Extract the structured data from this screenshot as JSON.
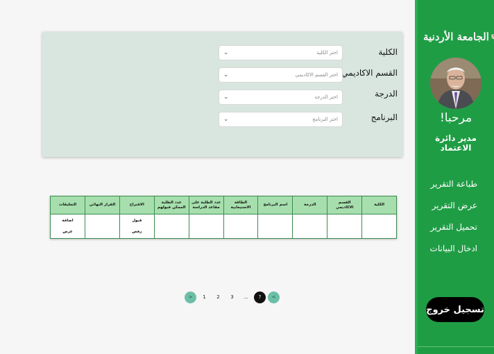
{
  "sidebar": {
    "logo_text": "الجامعة الأردنية",
    "greeting": "مرحبا!",
    "role": "مدير دائرة الاعتماد",
    "menu": [
      {
        "label": "طباعة التقرير"
      },
      {
        "label": "عرض التقرير"
      },
      {
        "label": "تحميل التقرير"
      },
      {
        "label": "ادخال البيانات"
      }
    ],
    "logout_label": "تسجيل خروج",
    "colors": {
      "background": "#1f9d45",
      "logout_bg": "#000000"
    }
  },
  "filters": {
    "faculty": {
      "label": "الكلية",
      "placeholder": "اختر الكلية"
    },
    "department": {
      "label": "القسم الاكاديمي",
      "placeholder": "اختر القسم الاكاديمي"
    },
    "degree": {
      "label": "الدرجة",
      "placeholder": "اختر الدرجة"
    },
    "program": {
      "label": "البرنامج",
      "placeholder": "اختر البرنامج"
    },
    "chevron_icon": "chevron-down-icon"
  },
  "table": {
    "headers": [
      "الكلية",
      "القسم الاكاديمي",
      "الدرجة",
      "اسم البرنامج",
      "الطاقة الاستيعابية",
      "عدد الطلبة على مقاعد الدراسة",
      "عدد الطلبة الممكن قبولهم",
      "الاقتراح",
      "القرار النهائي",
      "التعليقات"
    ],
    "suggestion_options": [
      "قبول",
      "رفض"
    ],
    "comment_actions": [
      "اضافة",
      "عرض"
    ],
    "header_color": "#a6dfad"
  },
  "pagination": {
    "pages": [
      "?",
      "...",
      "3",
      "2",
      "1"
    ],
    "prev_icon": "chevron-left-icon",
    "next_icon": "chevron-right-icon",
    "prev_label": "<",
    "next_label": ">",
    "active_color": "#111111",
    "arrow_color": "#6cbfa7"
  }
}
